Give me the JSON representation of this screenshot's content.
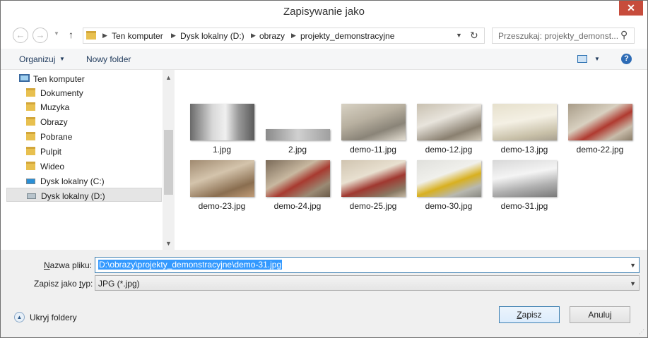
{
  "window": {
    "title": "Zapisywanie jako",
    "close_glyph": "✕"
  },
  "nav": {
    "back_glyph": "←",
    "forward_glyph": "→",
    "recent_glyph": "▼",
    "up_glyph": "↑",
    "breadcrumbs": [
      "Ten komputer",
      "Dysk lokalny (D:)",
      "obrazy",
      "projekty_demonstracyjne"
    ],
    "sep_glyph": "▶",
    "dropdown_glyph": "▼",
    "refresh_glyph": "↻"
  },
  "search": {
    "placeholder": "Przeszukaj: projekty_demonst...",
    "icon_glyph": "⚲"
  },
  "toolbar": {
    "organize_label": "Organizuj",
    "organize_arrow": "▼",
    "new_folder_label": "Nowy folder",
    "view_arrow": "▼",
    "help_glyph": "?"
  },
  "sidebar": {
    "up_glyph": "▲",
    "down_glyph": "▼",
    "items": [
      {
        "label": "Ten komputer",
        "icon": "computer-icon"
      },
      {
        "label": "Dokumenty",
        "icon": "documents-folder-icon"
      },
      {
        "label": "Muzyka",
        "icon": "music-folder-icon"
      },
      {
        "label": "Obrazy",
        "icon": "pictures-folder-icon"
      },
      {
        "label": "Pobrane",
        "icon": "downloads-folder-icon"
      },
      {
        "label": "Pulpit",
        "icon": "desktop-folder-icon"
      },
      {
        "label": "Wideo",
        "icon": "videos-folder-icon"
      },
      {
        "label": "Dysk lokalny (C:)",
        "icon": "windows-drive-icon"
      },
      {
        "label": "Dysk lokalny (D:)",
        "icon": "drive-icon",
        "selected": true
      }
    ]
  },
  "files": [
    {
      "name": "1.jpg"
    },
    {
      "name": "2.jpg"
    },
    {
      "name": "demo-11.jpg"
    },
    {
      "name": "demo-12.jpg"
    },
    {
      "name": "demo-13.jpg"
    },
    {
      "name": "demo-22.jpg"
    },
    {
      "name": "demo-23.jpg"
    },
    {
      "name": "demo-24.jpg"
    },
    {
      "name": "demo-25.jpg"
    },
    {
      "name": "demo-30.jpg"
    },
    {
      "name": "demo-31.jpg"
    }
  ],
  "form": {
    "filename_label_prefix": "N",
    "filename_label_rest": "azwa pliku:",
    "filename_value": "D:\\obrazy\\projekty_demonstracyjne\\demo-31.jpg",
    "type_label_prefix": "Zapisz jako ",
    "type_label_u": "t",
    "type_label_rest": "yp:",
    "type_value": "JPG (*.jpg)",
    "dropdown_glyph": "▼",
    "hide_folders_label": "Ukryj foldery",
    "hide_glyph": "▲",
    "save_u": "Z",
    "save_rest": "apisz",
    "cancel_label": "Anuluj",
    "grip_glyph": "⋰"
  }
}
